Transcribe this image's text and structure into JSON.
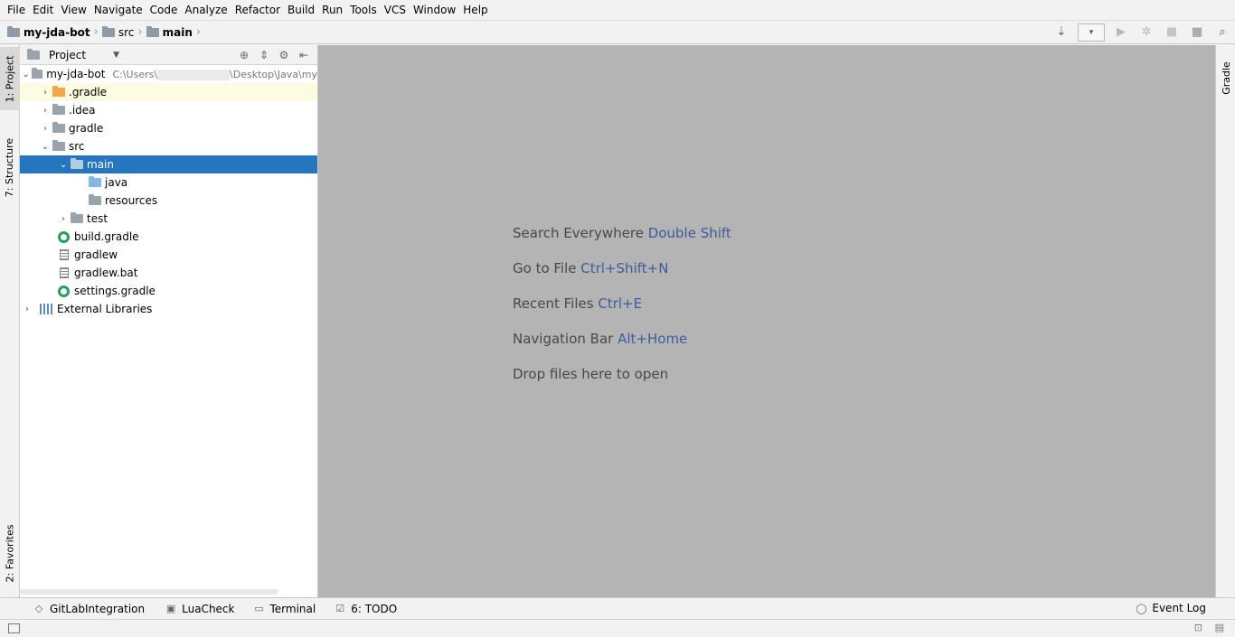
{
  "menu": [
    "File",
    "Edit",
    "View",
    "Navigate",
    "Code",
    "Analyze",
    "Refactor",
    "Build",
    "Run",
    "Tools",
    "VCS",
    "Window",
    "Help"
  ],
  "breadcrumb": {
    "project": "my-jda-bot",
    "src": "src",
    "main": "main"
  },
  "left_tabs": {
    "project": "1: Project",
    "structure": "7: Structure",
    "favorites": "2: Favorites"
  },
  "right_tabs": {
    "gradle": "Gradle"
  },
  "project_panel": {
    "title": "Project",
    "tree": [
      {
        "label": "my-jda-bot",
        "path_prefix": "C:\\Users\\",
        "path_suffix": "\\Desktop\\Java\\my"
      },
      {
        "label": ".gradle"
      },
      {
        "label": ".idea"
      },
      {
        "label": "gradle"
      },
      {
        "label": "src"
      },
      {
        "label": "main"
      },
      {
        "label": "java"
      },
      {
        "label": "resources"
      },
      {
        "label": "test"
      },
      {
        "label": "build.gradle"
      },
      {
        "label": "gradlew"
      },
      {
        "label": "gradlew.bat"
      },
      {
        "label": "settings.gradle"
      },
      {
        "label": "External Libraries"
      }
    ]
  },
  "editor_hints": [
    {
      "text": "Search Everywhere",
      "key": "Double Shift"
    },
    {
      "text": "Go to File",
      "key": "Ctrl+Shift+N"
    },
    {
      "text": "Recent Files",
      "key": "Ctrl+E"
    },
    {
      "text": "Navigation Bar",
      "key": "Alt+Home"
    },
    {
      "text": "Drop files here to open",
      "key": ""
    }
  ],
  "bottom_tabs": {
    "gitlab": "GitLabIntegration",
    "luacheck": "LuaCheck",
    "terminal": "Terminal",
    "todo": "6: TODO",
    "event_log": "Event Log"
  },
  "colors": {
    "selection": "#2675bf",
    "editor_bg": "#b4b4b4",
    "shortcut": "#3c5c9e"
  }
}
